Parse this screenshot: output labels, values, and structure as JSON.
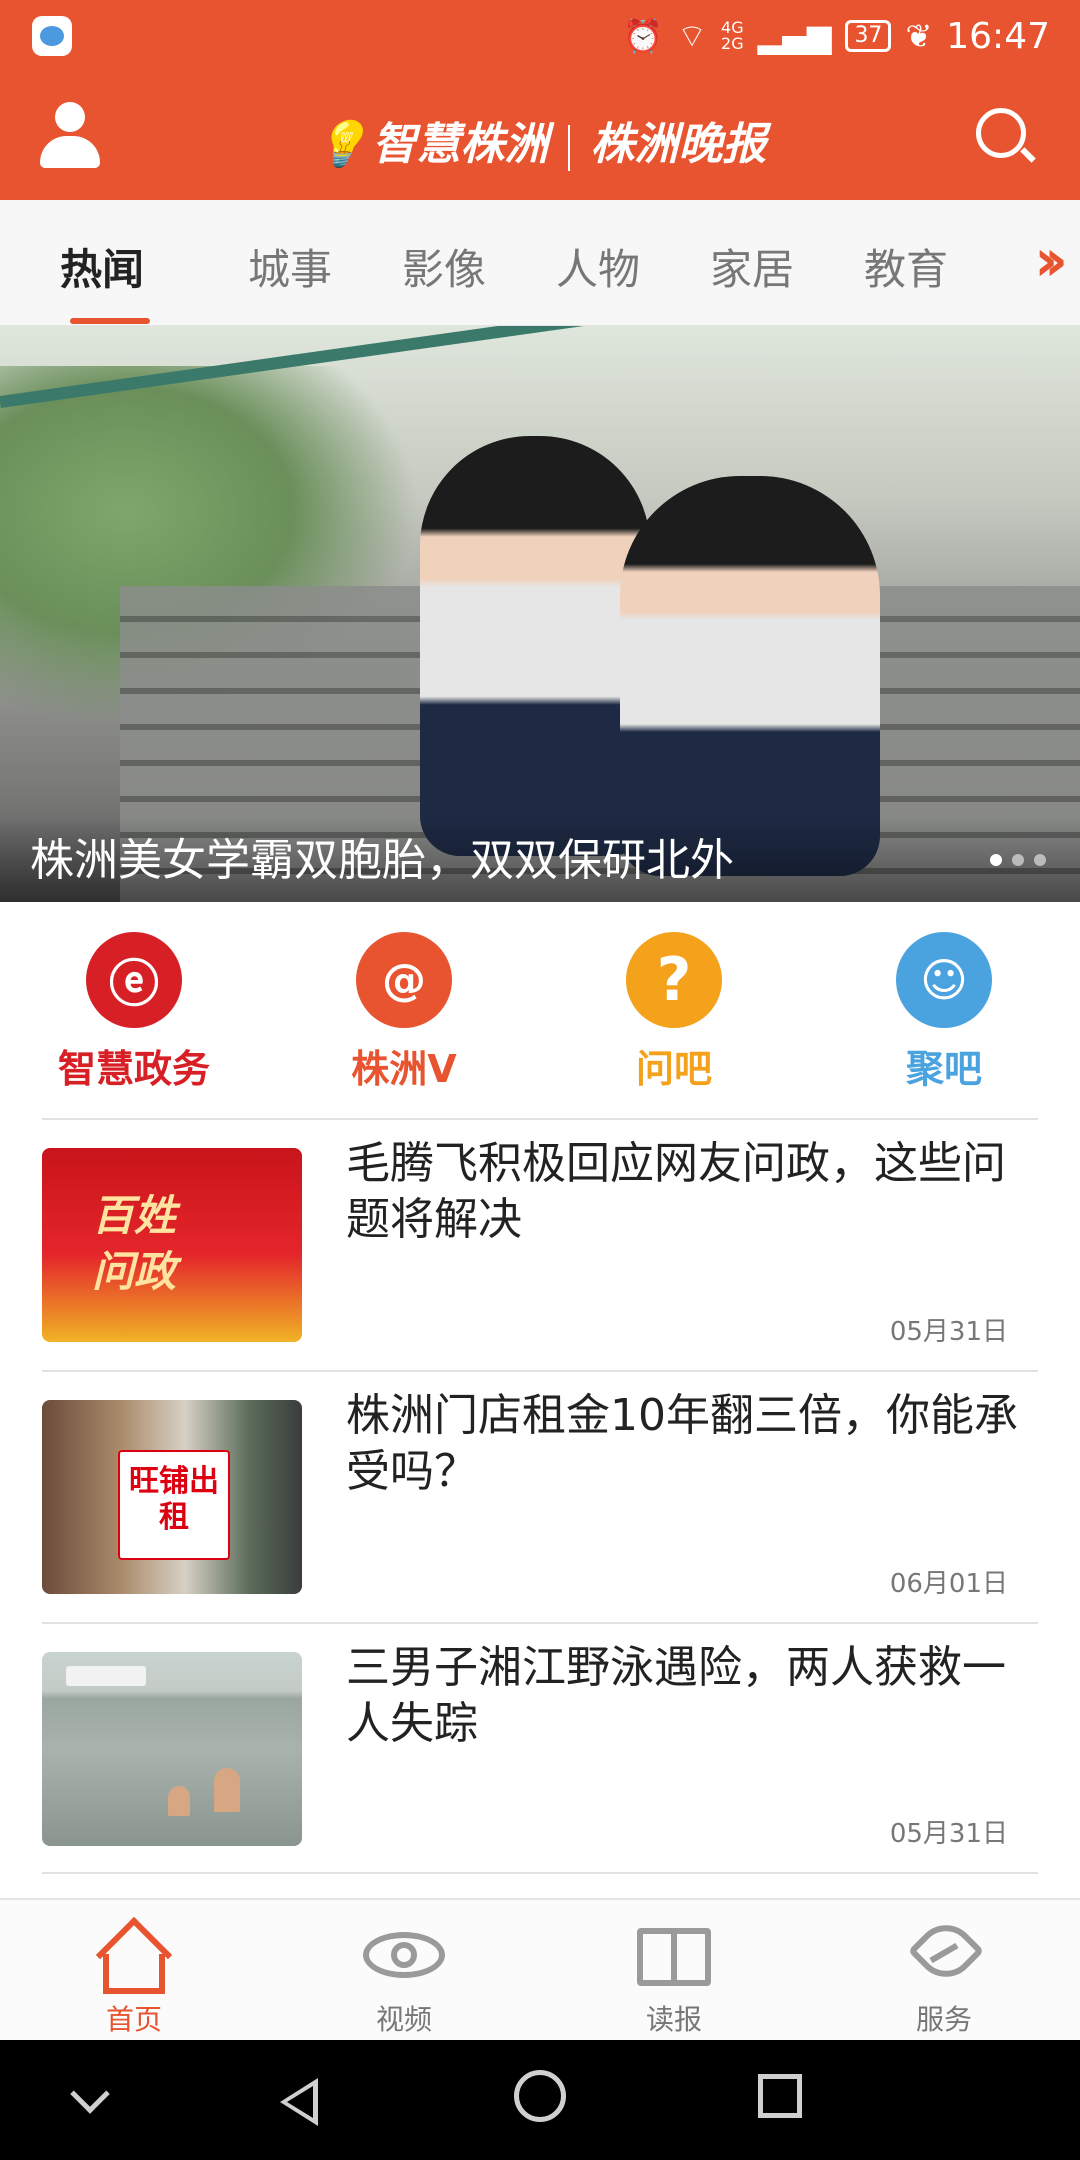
{
  "status_bar": {
    "network_top": "4G",
    "network_bottom": "2G",
    "battery": "37",
    "time": "16:47"
  },
  "header": {
    "brand_left": "智慧株洲",
    "brand_right": "株洲晚报"
  },
  "tabs": [
    {
      "label": "热闻",
      "active": true
    },
    {
      "label": "城事",
      "active": false
    },
    {
      "label": "影像",
      "active": false
    },
    {
      "label": "人物",
      "active": false
    },
    {
      "label": "家居",
      "active": false
    },
    {
      "label": "教育",
      "active": false
    }
  ],
  "hero": {
    "caption": "株洲美女学霸双胞胎，双双保研北外"
  },
  "quick_links": [
    {
      "label": "智慧政务",
      "icon": "e-house-icon",
      "color": "#d71f26"
    },
    {
      "label": "株洲V",
      "icon": "at-person-icon",
      "color": "#e8542f"
    },
    {
      "label": "问吧",
      "icon": "question-icon",
      "color": "#f4a11c"
    },
    {
      "label": "聚吧",
      "icon": "chat-face-icon",
      "color": "#4aa3df"
    }
  ],
  "news": [
    {
      "title": "毛腾飞积极回应网友问政，这些问题将解决",
      "date": "05月31日",
      "thumb_text_1": "百姓",
      "thumb_text_2": "问政"
    },
    {
      "title": "株洲门店租金10年翻三倍，你能承受吗？",
      "date": "06月01日",
      "thumb_text_1": "旺铺出租"
    },
    {
      "title": "三男子湘江野泳遇险，两人获救一人失踪",
      "date": "05月31日"
    }
  ],
  "bottom_nav": [
    {
      "label": "首页",
      "icon": "home-icon",
      "active": true
    },
    {
      "label": "视频",
      "icon": "eye-icon",
      "active": false
    },
    {
      "label": "读报",
      "icon": "book-icon",
      "active": false
    },
    {
      "label": "服务",
      "icon": "heart-hand-icon",
      "active": false
    }
  ],
  "colors": {
    "accent": "#e8542f",
    "red": "#d71f26",
    "orange": "#f4a11c",
    "blue": "#4aa3df"
  }
}
